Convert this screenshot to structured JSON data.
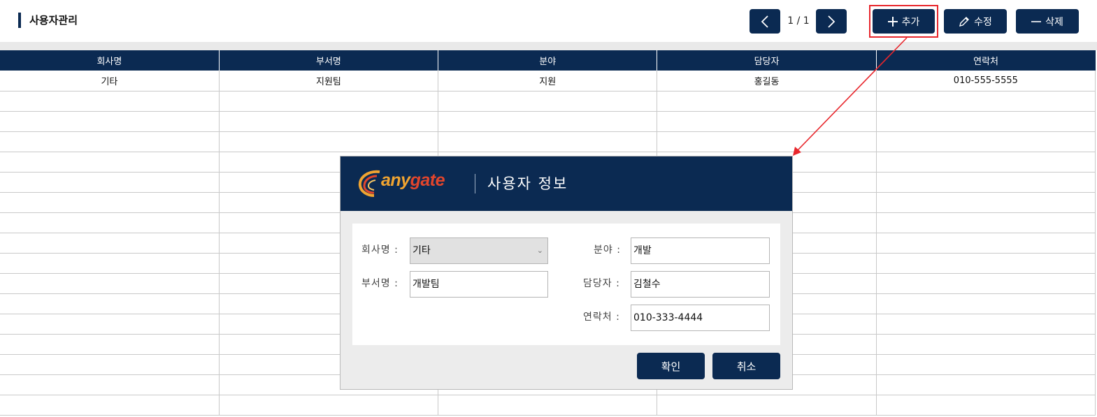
{
  "header": {
    "title": "사용자관리",
    "pager": "1 / 1",
    "add_label": "추가",
    "edit_label": "수정",
    "delete_label": "삭제"
  },
  "table": {
    "columns": [
      "회사명",
      "부서명",
      "분야",
      "담당자",
      "연락처"
    ],
    "rows": [
      [
        "기타",
        "지원팀",
        "지원",
        "홍길동",
        "010-555-5555"
      ]
    ]
  },
  "dialog": {
    "logo_any": "any",
    "logo_gate": "gate",
    "title": "사용자 정보",
    "company_label": "회사명 :",
    "company_value": "기타",
    "department_label": "부서명 :",
    "department_value": "개발팀",
    "field_label": "분야 :",
    "field_value": "개발",
    "manager_label": "담당자 :",
    "manager_value": "김철수",
    "contact_label": "연락처 :",
    "contact_value": "010-333-4444",
    "ok_label": "확인",
    "cancel_label": "취소"
  },
  "colors": {
    "navy": "#0b2a52",
    "highlight": "#e8262c",
    "logo_orange": "#f0a431",
    "logo_red": "#e2452c"
  },
  "icons": {
    "prev": "chevron-left-icon",
    "next": "chevron-right-icon",
    "add": "plus-icon",
    "edit": "pencil-icon",
    "delete": "minus-icon",
    "dropdown": "chevron-down-icon"
  }
}
